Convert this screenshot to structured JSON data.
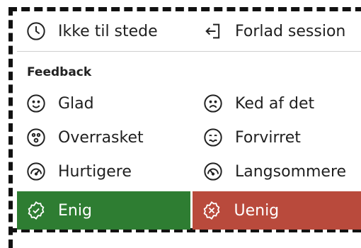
{
  "status_items": [
    {
      "label": "Ikke til stede",
      "icon": "clock-icon"
    },
    {
      "label": "Forlad session",
      "icon": "leave-session-icon"
    }
  ],
  "feedback": {
    "title": "Feedback",
    "items": [
      {
        "label": "Glad",
        "icon": "smile-icon"
      },
      {
        "label": "Ked af det",
        "icon": "sad-icon"
      },
      {
        "label": "Overrasket",
        "icon": "surprised-icon"
      },
      {
        "label": "Forvirret",
        "icon": "confused-icon"
      },
      {
        "label": "Hurtigere",
        "icon": "speedometer-fast-icon"
      },
      {
        "label": "Langsommere",
        "icon": "speedometer-slow-icon"
      }
    ]
  },
  "actions": {
    "agree": {
      "label": "Enig",
      "icon": "agree-badge-icon",
      "color": "#2e7d32"
    },
    "disagree": {
      "label": "Uenig",
      "icon": "disagree-badge-icon",
      "color": "#b94a3c"
    }
  }
}
